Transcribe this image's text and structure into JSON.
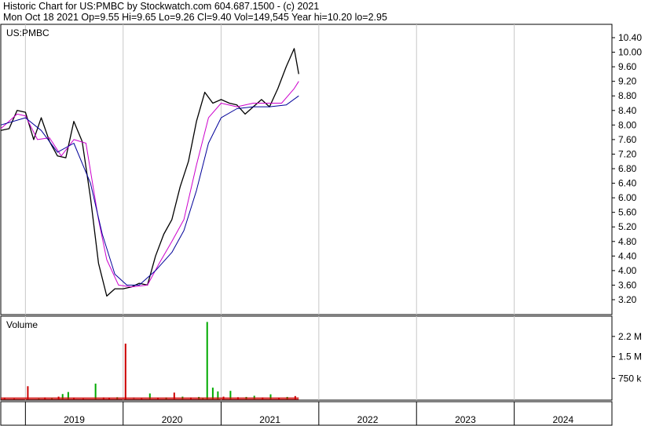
{
  "header": {
    "line1": "Historic Chart for US:PMBC by Stockwatch.com 604.687.1500 - (c) 2021",
    "line2": "Mon Oct 18 2021   Op=9.55  Hi=9.65  Lo=9.26  Cl=9.40  Vol=149,545  Year hi=10.20  lo=2.95"
  },
  "chart_data": [
    {
      "type": "line",
      "title": "US:PMBC",
      "ylim": [
        2.95,
        10.6
      ],
      "yticks": [
        "10.40",
        "10.00",
        "9.60",
        "9.20",
        "8.80",
        "8.40",
        "8.00",
        "7.60",
        "7.20",
        "6.80",
        "6.40",
        "6.00",
        "5.60",
        "5.20",
        "4.80",
        "4.40",
        "4.00",
        "3.60",
        "3.20"
      ],
      "xlabels": [
        "2019",
        "2020",
        "2021",
        "2022",
        "2023",
        "2024"
      ],
      "x_domain": [
        "2018-10-01",
        "2024-12-31"
      ],
      "series": [
        {
          "color": "#000000",
          "x": [
            "2018-10-01",
            "2018-11-01",
            "2018-12-01",
            "2019-01-01",
            "2019-02-01",
            "2019-03-01",
            "2019-04-01",
            "2019-05-01",
            "2019-06-01",
            "2019-07-01",
            "2019-08-01",
            "2019-09-01",
            "2019-10-01",
            "2019-11-01",
            "2019-12-01",
            "2020-01-01",
            "2020-02-01",
            "2020-03-01",
            "2020-04-01",
            "2020-05-01",
            "2020-06-01",
            "2020-07-01",
            "2020-08-01",
            "2020-09-01",
            "2020-10-01",
            "2020-11-01",
            "2020-12-01",
            "2021-01-01",
            "2021-02-01",
            "2021-03-01",
            "2021-04-01",
            "2021-05-01",
            "2021-06-01",
            "2021-07-01",
            "2021-08-01",
            "2021-09-01",
            "2021-10-01",
            "2021-10-18"
          ],
          "y": [
            7.85,
            7.9,
            8.4,
            8.35,
            7.6,
            8.2,
            7.55,
            7.15,
            7.1,
            8.1,
            7.55,
            6.0,
            4.2,
            3.3,
            3.5,
            3.5,
            3.55,
            3.65,
            3.6,
            4.4,
            5.0,
            5.4,
            6.3,
            7.0,
            8.1,
            8.9,
            8.6,
            8.7,
            8.6,
            8.55,
            8.3,
            8.5,
            8.7,
            8.5,
            9.0,
            9.6,
            10.1,
            9.4
          ]
        },
        {
          "color": "#cc00cc",
          "x": [
            "2018-10-01",
            "2018-12-01",
            "2019-01-01",
            "2019-02-15",
            "2019-04-01",
            "2019-05-15",
            "2019-07-01",
            "2019-08-15",
            "2019-10-01",
            "2019-11-01",
            "2019-12-15",
            "2020-02-01",
            "2020-04-01",
            "2020-05-15",
            "2020-07-01",
            "2020-08-15",
            "2020-10-01",
            "2020-11-15",
            "2021-01-01",
            "2021-03-01",
            "2021-05-01",
            "2021-07-01",
            "2021-08-15",
            "2021-10-01",
            "2021-10-18"
          ],
          "y": [
            7.9,
            8.3,
            8.25,
            7.6,
            7.65,
            7.15,
            7.6,
            7.5,
            5.4,
            4.3,
            3.6,
            3.55,
            3.6,
            4.2,
            4.8,
            5.4,
            6.9,
            8.2,
            8.6,
            8.5,
            8.6,
            8.6,
            8.6,
            9.0,
            9.2
          ]
        },
        {
          "color": "#000099",
          "x": [
            "2018-10-01",
            "2019-01-01",
            "2019-03-01",
            "2019-05-01",
            "2019-07-01",
            "2019-09-01",
            "2019-10-15",
            "2019-12-01",
            "2020-01-15",
            "2020-03-01",
            "2020-05-01",
            "2020-07-01",
            "2020-08-15",
            "2020-10-01",
            "2020-11-15",
            "2021-01-01",
            "2021-03-01",
            "2021-05-01",
            "2021-07-01",
            "2021-09-01",
            "2021-10-18"
          ],
          "y": [
            8.0,
            8.2,
            7.85,
            7.25,
            7.5,
            6.4,
            5.0,
            3.9,
            3.6,
            3.6,
            4.0,
            4.5,
            5.1,
            6.2,
            7.5,
            8.2,
            8.45,
            8.5,
            8.5,
            8.55,
            8.8
          ]
        }
      ]
    },
    {
      "type": "bar",
      "title": "Volume",
      "ylim": [
        0,
        2900000
      ],
      "yticks": [
        "2.2 M",
        "1.5 M",
        "750 k"
      ],
      "x": [
        "2018-10-15",
        "2018-11-20",
        "2019-01-10",
        "2019-02-20",
        "2019-03-15",
        "2019-04-10",
        "2019-05-05",
        "2019-05-20",
        "2019-06-10",
        "2019-07-01",
        "2019-08-05",
        "2019-09-20",
        "2019-10-20",
        "2019-11-10",
        "2019-12-10",
        "2020-01-10",
        "2020-02-10",
        "2020-03-10",
        "2020-04-10",
        "2020-05-10",
        "2020-06-10",
        "2020-07-10",
        "2020-08-10",
        "2020-09-10",
        "2020-10-10",
        "2020-10-25",
        "2020-11-10",
        "2020-12-01",
        "2020-12-20",
        "2021-01-10",
        "2021-02-05",
        "2021-03-05",
        "2021-04-05",
        "2021-05-05",
        "2021-06-05",
        "2021-07-05",
        "2021-08-05",
        "2021-09-05",
        "2021-10-05"
      ],
      "values": [
        80000,
        60000,
        480000,
        60000,
        90000,
        70000,
        120000,
        210000,
        280000,
        80000,
        60000,
        570000,
        90000,
        80000,
        100000,
        1950000,
        90000,
        70000,
        230000,
        80000,
        90000,
        260000,
        120000,
        90000,
        110000,
        70000,
        2700000,
        430000,
        300000,
        120000,
        320000,
        100000,
        110000,
        150000,
        90000,
        200000,
        80000,
        110000,
        140000
      ],
      "colors": [
        "#cc0000",
        "#cc0000",
        "#cc0000",
        "#00aa00",
        "#cc0000",
        "#00aa00",
        "#cc0000",
        "#00aa00",
        "#00aa00",
        "#cc0000",
        "#cc0000",
        "#00aa00",
        "#cc0000",
        "#cc0000",
        "#00aa00",
        "#cc0000",
        "#888888",
        "#cc0000",
        "#00aa00",
        "#cc0000",
        "#00aa00",
        "#cc0000",
        "#00aa00",
        "#cc0000",
        "#00aa00",
        "#00aa00",
        "#00aa00",
        "#00aa00",
        "#00aa00",
        "#cc0000",
        "#00aa00",
        "#cc0000",
        "#00aa00",
        "#00aa00",
        "#cc0000",
        "#00aa00",
        "#cc0000",
        "#00aa00",
        "#cc0000"
      ]
    }
  ]
}
